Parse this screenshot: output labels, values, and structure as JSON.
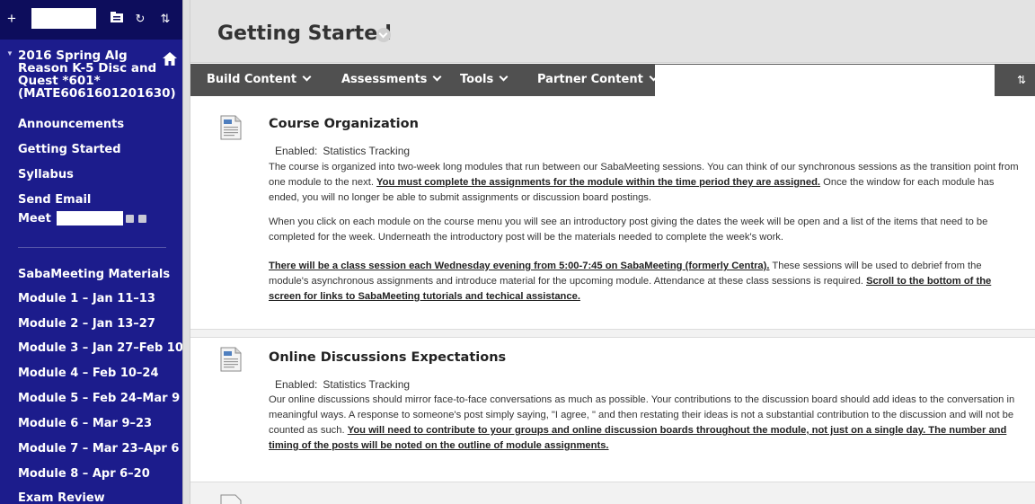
{
  "sidebar": {
    "course_title": "2016 Spring Alg Reason K-5 Disc and Quest *601* (MATE6061601201630)",
    "nav": [
      {
        "label": "Announcements"
      },
      {
        "label": "Getting Started"
      },
      {
        "label": "Syllabus"
      },
      {
        "label": "Send Email"
      },
      {
        "label": "Meet"
      }
    ],
    "modules": [
      {
        "label": "SabaMeeting Materials"
      },
      {
        "label": "Module 1 – Jan 11–13"
      },
      {
        "label": "Module 2 – Jan 13–27"
      },
      {
        "label": "Module 3 – Jan 27–Feb 10"
      },
      {
        "label": "Module 4 – Feb 10–24"
      },
      {
        "label": "Module 5 – Feb 24–Mar 9"
      },
      {
        "label": "Module 6 – Mar 9–23"
      },
      {
        "label": "Module 7 – Mar 23–Apr 6"
      },
      {
        "label": "Module 8 – Apr 6–20"
      },
      {
        "label": "Exam Review"
      }
    ],
    "toolbar": {
      "add": "+",
      "refresh": "↻",
      "sort": "⇅"
    }
  },
  "page": {
    "title": "Getting Started"
  },
  "toolbar": {
    "menus": [
      {
        "label": "Build Content"
      },
      {
        "label": "Assessments"
      },
      {
        "label": "Tools"
      },
      {
        "label": "Partner Content"
      }
    ],
    "sort_icon": "⇅"
  },
  "items": [
    {
      "title": "Course Organization",
      "enabled_label": "Enabled:",
      "enabled_value": "Statistics Tracking",
      "p1_a": "The course is organized into two-week long modules that run between our SabaMeeting sessions.  You can think of our synchronous sessions as the transition point from one module to the next. ",
      "p1_b": "You must complete the assignments for the module within the time period they are assigned.",
      "p1_c": " Once the window for each module has ended, you will no longer be able to submit assignments or discussion board postings.",
      "p2": "When you click on each module on the course menu you will see an introductory post giving the dates the week will be open and a list of the items that need to be completed for the week. Underneath the introductory post will be the materials needed to complete the week's work.",
      "p3_a": "There will be a class session each Wednesday evening from 5:00-7:45 on SabaMeeting (formerly Centra).",
      "p3_b": "  These sessions will be used to debrief from the module's asynchronous assignments and introduce material for the upcoming module. Attendance at these class sessions is required. ",
      "p3_c": "Scroll to the bottom of the screen for links to SabaMeeting tutorials and techical assistance."
    },
    {
      "title": "Online Discussions Expectations",
      "enabled_label": "Enabled:",
      "enabled_value": "Statistics Tracking",
      "p1_a": "Our online discussions should mirror face-to-face conversations as much as possible. Your contributions to the discussion board should add ideas to the conversation in meaningful ways. A response to someone's post simply saying, \"I agree, \" and then restating their ideas is not a substantial contribution to the discussion and will not be counted as such. ",
      "p1_b": "You will need to contribute to your groups and online discussion boards throughout the module, not just on a single day.  The number and timing of the posts will be noted on the outline of module assignments."
    }
  ]
}
